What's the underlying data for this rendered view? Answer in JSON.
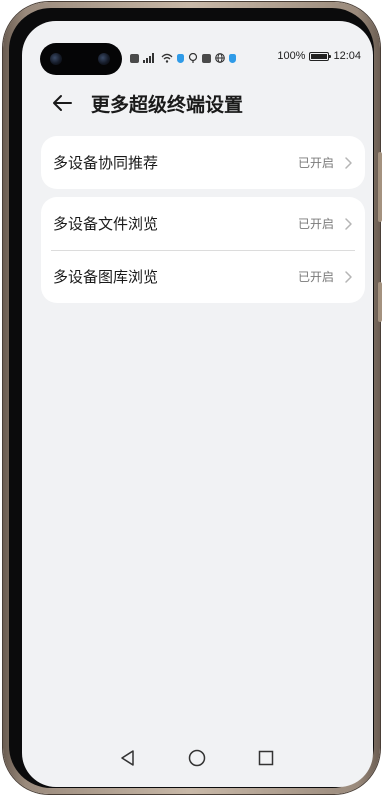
{
  "status_bar": {
    "battery_percent_label": "100%",
    "battery_level": 1.0,
    "time": "12:04",
    "icons": [
      "hd-icon",
      "signal-icon",
      "wifi-icon",
      "shield-icon",
      "cast-icon",
      "sim-icon",
      "globe-icon",
      "shield-icon"
    ]
  },
  "header": {
    "title": "更多超级终端设置",
    "back_icon": "arrow-left-icon"
  },
  "settings_groups": [
    {
      "items": [
        {
          "label": "多设备协同推荐",
          "status": "已开启",
          "icon": "chevron-right-icon"
        }
      ]
    },
    {
      "items": [
        {
          "label": "多设备文件浏览",
          "status": "已开启",
          "icon": "chevron-right-icon"
        },
        {
          "label": "多设备图库浏览",
          "status": "已开启",
          "icon": "chevron-right-icon"
        }
      ]
    }
  ],
  "nav_bar": {
    "icons": [
      "back-triangle-icon",
      "home-circle-icon",
      "recents-square-icon"
    ]
  },
  "colors": {
    "screen_background": "#f1f2f4",
    "card_background": "#ffffff",
    "text_primary": "#1a1a1a",
    "text_secondary": "#7a7a7a",
    "status_blue": "#2f9be8",
    "frame": "#c9b9a8"
  }
}
